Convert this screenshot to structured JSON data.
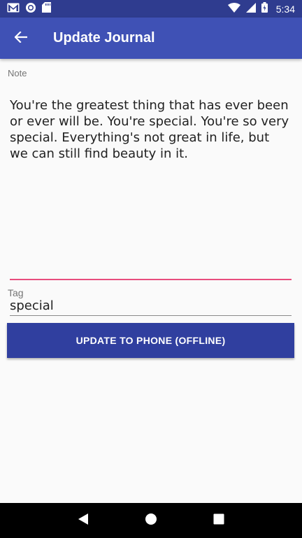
{
  "status_bar": {
    "time": "5:34",
    "icons": [
      "gmail-icon",
      "sync-icon",
      "sd-card-icon",
      "wifi-icon",
      "signal-icon",
      "battery-icon"
    ]
  },
  "app_bar": {
    "title": "Update Journal",
    "background": "#3f51b5",
    "back_icon": "arrow-back-icon"
  },
  "note": {
    "label": "Note",
    "value": "You're the greatest thing that has ever been or ever will be. You're special. You're so very special. Everything's not great in life, but we can still find beauty in it.",
    "underline_color": "#e84d7e"
  },
  "tag": {
    "label": "Tag",
    "value": "special"
  },
  "update_button": {
    "label": "UPDATE TO PHONE (OFFLINE)",
    "background": "#303f9f"
  },
  "nav_bar": {
    "icons": [
      "back-triangle-icon",
      "home-circle-icon",
      "recents-square-icon"
    ]
  }
}
